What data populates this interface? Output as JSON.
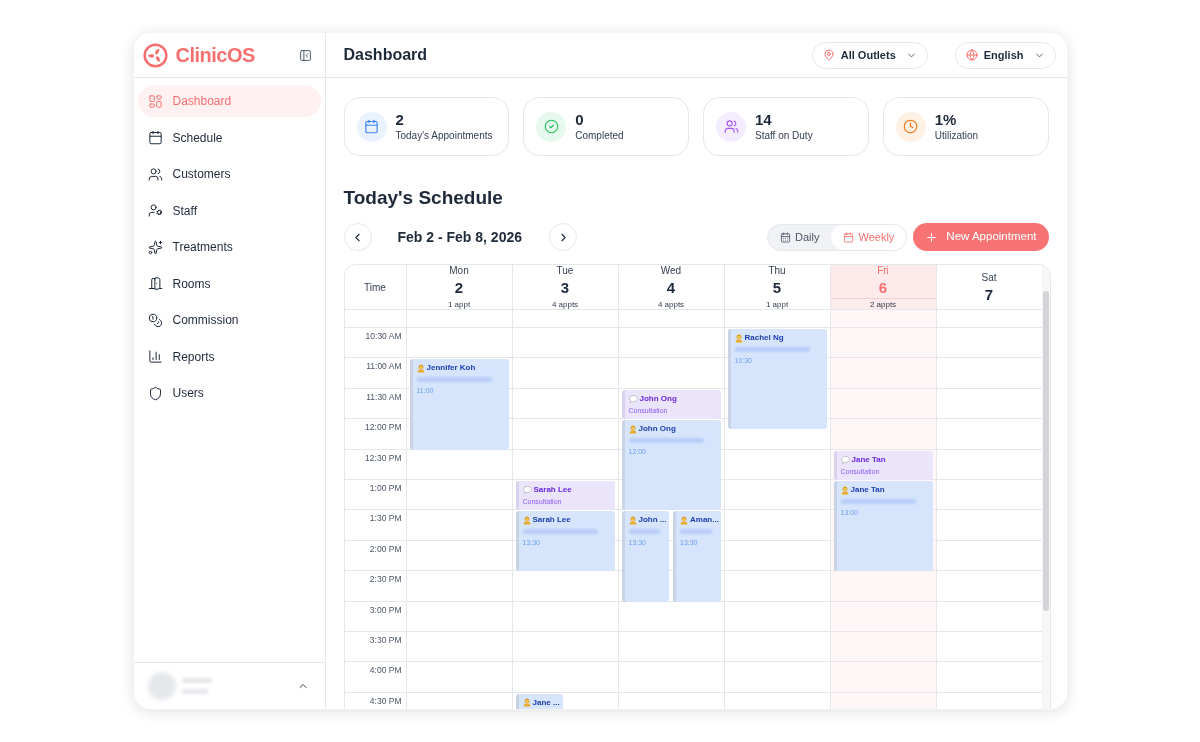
{
  "sidebar": {
    "logo": "ClinicOS",
    "items": [
      {
        "label": "Dashboard",
        "selected": true
      },
      {
        "label": "Schedule",
        "selected": false
      },
      {
        "label": "Customers",
        "selected": false
      },
      {
        "label": "Staff",
        "selected": false
      },
      {
        "label": "Treatments",
        "selected": false
      },
      {
        "label": "Rooms",
        "selected": false
      },
      {
        "label": "Commission",
        "selected": false
      },
      {
        "label": "Reports",
        "selected": false
      },
      {
        "label": "Users",
        "selected": false
      }
    ]
  },
  "header": {
    "title": "Dashboard",
    "outlet_filter": "All Outlets",
    "language": "English"
  },
  "stats": [
    {
      "kind": "appointments",
      "value": "2",
      "label": "Today's Appointments"
    },
    {
      "kind": "completed",
      "value": "0",
      "label": "Completed"
    },
    {
      "kind": "staff",
      "value": "14",
      "label": "Staff on Duty"
    },
    {
      "kind": "utilization",
      "value": "1%",
      "label": "Utilization"
    }
  ],
  "schedule": {
    "title": "Today's Schedule",
    "date_range": "Feb 2 - Feb 8, 2026",
    "views": [
      {
        "label": "Daily",
        "selected": false
      },
      {
        "label": "Weekly",
        "selected": true
      }
    ],
    "new_button": "New Appointment",
    "calendar": {
      "time_heading": "Time",
      "time_slots": [
        "10:30 AM",
        "11:00 AM",
        "11:30 AM",
        "12:00 PM",
        "12:30 PM",
        "1:00 PM",
        "1:30 PM",
        "2:00 PM",
        "2:30 PM",
        "3:00 PM",
        "3:30 PM",
        "4:00 PM",
        "4:30 PM"
      ],
      "days": [
        {
          "name": "Mon",
          "date": "2",
          "count": "1 appt",
          "today": false,
          "events": [
            {
              "kind": "treatment",
              "name": "Jennifer Koh",
              "time": "11:00"
            }
          ]
        },
        {
          "name": "Tue",
          "date": "3",
          "count": "4 appts",
          "today": false,
          "events": [
            {
              "kind": "consultation",
              "name": "Sarah Lee",
              "type": "Consultation"
            },
            {
              "kind": "treatment",
              "name": "Sarah Lee",
              "time": "13:30"
            },
            {
              "kind": "treatment",
              "name": "Jane ..."
            }
          ]
        },
        {
          "name": "Wed",
          "date": "4",
          "count": "4 appts",
          "today": false,
          "events": [
            {
              "kind": "consultation",
              "name": "John Ong",
              "type": "Consultation"
            },
            {
              "kind": "treatment",
              "name": "John Ong",
              "time": "12:00"
            },
            {
              "kind": "treatment",
              "name": "John ...",
              "time": "13:30"
            },
            {
              "kind": "treatment",
              "name": "Aman...",
              "time": "13:30"
            }
          ]
        },
        {
          "name": "Thu",
          "date": "5",
          "count": "1 appt",
          "today": false,
          "events": [
            {
              "kind": "treatment",
              "name": "Rachel Ng",
              "time": "10:30"
            }
          ]
        },
        {
          "name": "Fri",
          "date": "6",
          "count": "2 appts",
          "today": true,
          "events": [
            {
              "kind": "consultation",
              "name": "Jane Tan",
              "type": "Consultation"
            },
            {
              "kind": "treatment",
              "name": "Jane Tan",
              "time": "13:00"
            }
          ]
        },
        {
          "name": "Sat",
          "date": "7",
          "today": false
        }
      ]
    }
  }
}
